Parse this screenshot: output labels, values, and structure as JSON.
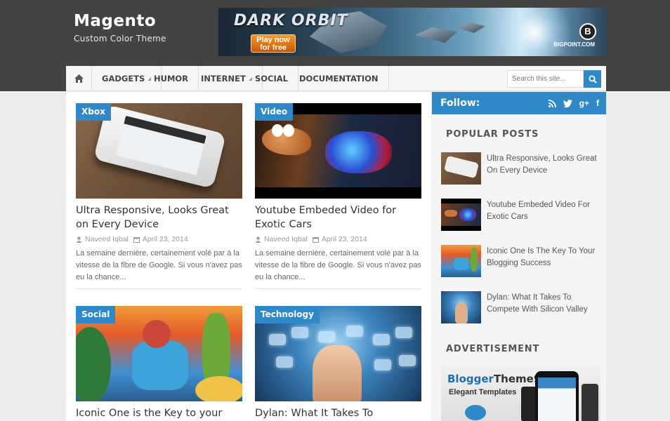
{
  "site": {
    "title": "Magento",
    "tagline": "Custom Color Theme"
  },
  "banner": {
    "logo_text": "DARK ORBIT",
    "play_label": "Play now\nfor free",
    "brand_mark": "B",
    "brand_text": "BIGPOINT.COM"
  },
  "nav": {
    "home_icon": "home-icon",
    "items": [
      {
        "label": "GADGETS",
        "has_dropdown": true
      },
      {
        "label": "HUMOR",
        "has_dropdown": false
      },
      {
        "label": "INTERNET",
        "has_dropdown": true
      },
      {
        "label": "SOCIAL",
        "has_dropdown": false
      },
      {
        "label": "DOCUMENTATION",
        "has_dropdown": false
      }
    ],
    "search_placeholder": "Search this site...",
    "search_icon": "search-icon"
  },
  "posts": [
    {
      "category": "Xbox",
      "title": "Ultra Responsive, Looks Great on Every Device",
      "author": "Naveed Iqbal",
      "date": "April 23, 2014",
      "excerpt": "La semaine dernière, certainement volé par à la vitesse de la fibre de Google. Si vous n'avez pas eu la chance..."
    },
    {
      "category": "Video",
      "title": "Youtube Embeded Video for Exotic Cars",
      "author": "Naveed Iqbal",
      "date": "April 23, 2014",
      "excerpt": "La semaine dernière, certainement volé par à la vitesse de la fibre de Google. Si vous n'avez pas eu la chance..."
    },
    {
      "category": "Social",
      "title": "Iconic One is the Key to your",
      "author": "",
      "date": "",
      "excerpt": ""
    },
    {
      "category": "Technology",
      "title": "Dylan: What It Takes To Compete",
      "author": "",
      "date": "",
      "excerpt": ""
    }
  ],
  "sidebar": {
    "follow_label": "Follow:",
    "social_icons": [
      "rss-icon",
      "twitter-icon",
      "googleplus-icon",
      "facebook-icon"
    ],
    "social_glyphs": [
      ")",
      "t",
      "g+",
      "f"
    ],
    "popular_title": "POPULAR POSTS",
    "popular": [
      {
        "title": "Ultra Responsive, Looks Great On Every Device"
      },
      {
        "title": "Youtube Embeded Video For Exotic Cars"
      },
      {
        "title": "Iconic One Is The Key To Your Blogging Success"
      },
      {
        "title": "Dylan: What It Takes To Compete With Silicon Valley"
      }
    ],
    "ad_title": "ADVERTISEMENT",
    "ad": {
      "brand_blue": "Blogger",
      "brand_dark": "Theme9",
      "tagline": "Elegant Templates"
    }
  },
  "colors": {
    "accent": "#2f88c8",
    "header_bg": "#434343"
  }
}
